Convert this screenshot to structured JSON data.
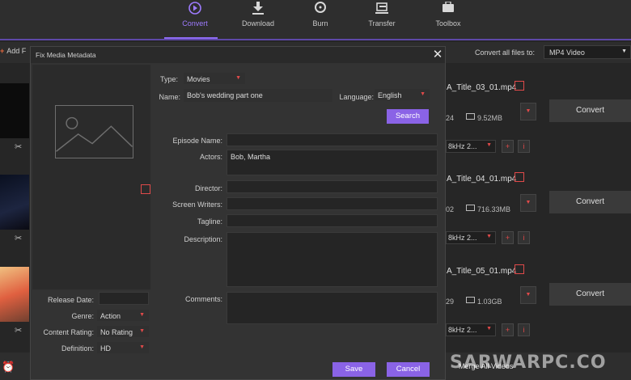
{
  "nav": {
    "items": [
      {
        "label": "Convert",
        "icon": "play-circle-icon"
      },
      {
        "label": "Download",
        "icon": "download-icon"
      },
      {
        "label": "Burn",
        "icon": "disc-icon"
      },
      {
        "label": "Transfer",
        "icon": "transfer-icon"
      },
      {
        "label": "Toolbox",
        "icon": "toolbox-icon"
      }
    ],
    "active": "Convert",
    "accent": "#8e6cf2"
  },
  "toolbar": {
    "add_files_label": "Add F",
    "convert_all_label": "Convert all files to:",
    "format_value": "MP4 Video"
  },
  "files": [
    {
      "name": "A_Title_03_01.mp4",
      "meta_left": "24",
      "size": "9.52MB",
      "audio": "8kHz 2...",
      "convert_label": "Convert"
    },
    {
      "name": "A_Title_04_01.mp4",
      "meta_left": "02",
      "size": "716.33MB",
      "audio": "8kHz 2...",
      "convert_label": "Convert"
    },
    {
      "name": "A_Title_05_01.mp4",
      "meta_left": "29",
      "size": "1.03GB",
      "audio": "8kHz 2...",
      "convert_label": "Convert"
    }
  ],
  "bottom": {
    "merge_label": "Merge All Videos",
    "watermark": "SARWARPC.CO"
  },
  "dialog": {
    "title": "Fix Media Metadata",
    "type_label": "Type:",
    "type_value": "Movies",
    "name_label": "Name:",
    "name_value": "Bob's wedding part one",
    "language_label": "Language:",
    "language_value": "English",
    "search_label": "Search",
    "episode_label": "Episode Name:",
    "episode_value": "",
    "actors_label": "Actors:",
    "actors_value": "Bob, Martha",
    "director_label": "Director:",
    "director_value": "",
    "writers_label": "Screen Writers:",
    "writers_value": "",
    "tagline_label": "Tagline:",
    "tagline_value": "",
    "description_label": "Description:",
    "description_value": "",
    "comments_label": "Comments:",
    "comments_value": "",
    "release_label": "Release Date:",
    "release_value": "",
    "genre_label": "Genre:",
    "genre_value": "Action",
    "rating_label": "Content Rating:",
    "rating_value": "No Rating",
    "definition_label": "Definition:",
    "definition_value": "HD",
    "save_label": "Save",
    "cancel_label": "Cancel",
    "button_color": "#8a63e6",
    "edit_icon_color": "#e04a4a"
  }
}
